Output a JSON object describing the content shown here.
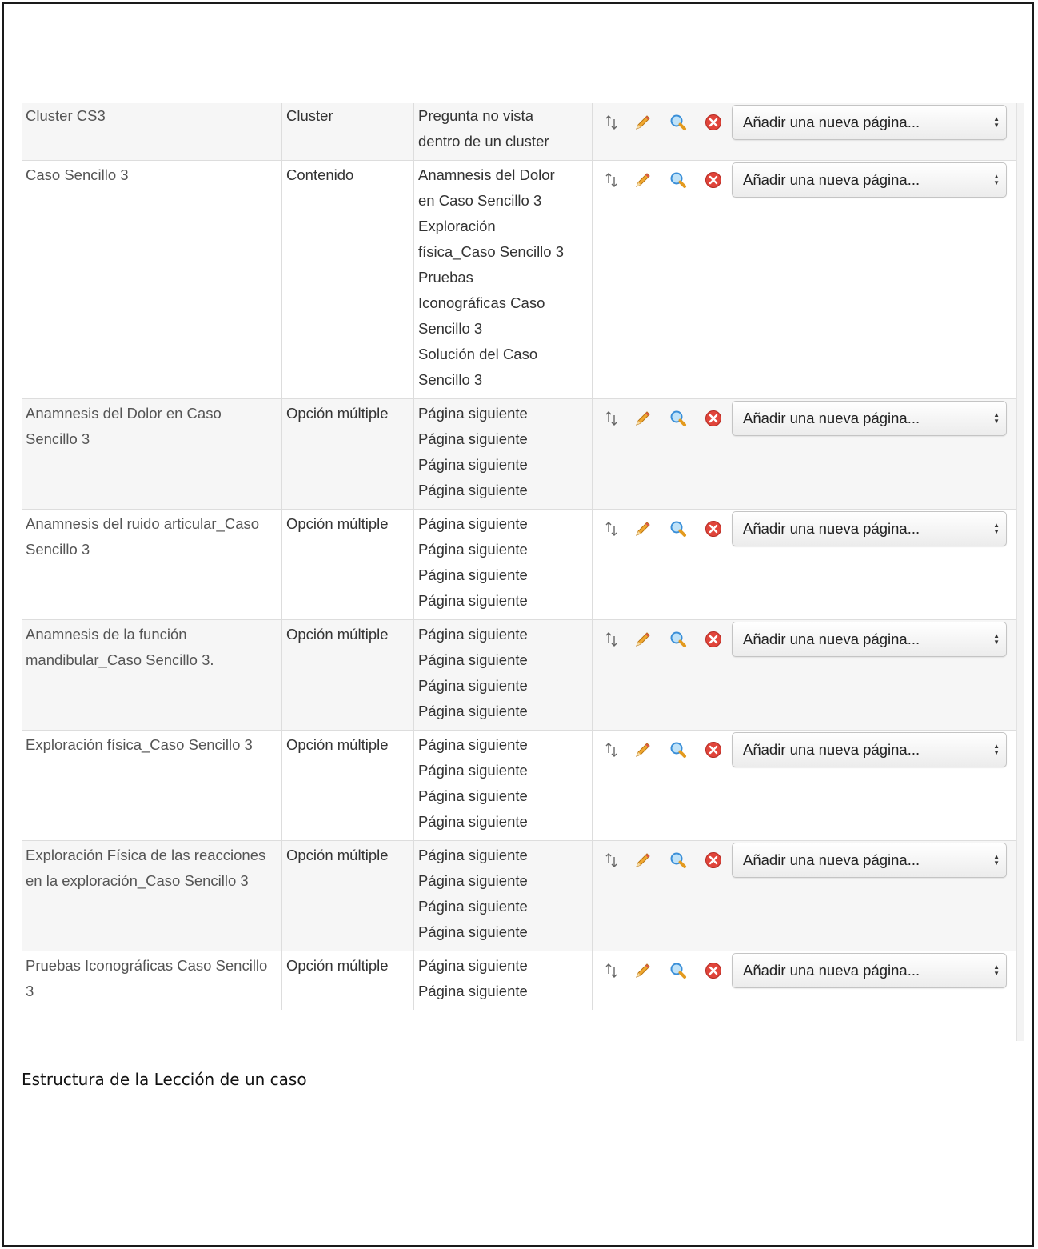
{
  "colors": {
    "row_alt": "#f6f6f6",
    "border": "#dddddd",
    "pencil": "#f0a830",
    "search": "#3a8fd8",
    "delete": "#e0453b"
  },
  "icons": {
    "move": "move-arrows-icon",
    "edit": "pencil-icon",
    "preview": "magnifier-icon",
    "delete": "delete-icon"
  },
  "rows": [
    {
      "title": "Cluster CS3",
      "type": "Cluster",
      "jumps": [
        "Pregunta no vista",
        "dentro de un cluster"
      ],
      "select": "Añadir una nueva página..."
    },
    {
      "title": "Caso Sencillo 3",
      "type": "Contenido",
      "jumps": [
        "Anamnesis del Dolor",
        "en Caso Sencillo 3",
        "Exploración",
        "física_Caso Sencillo 3",
        "Pruebas",
        "Iconográficas Caso",
        "Sencillo 3",
        "Solución del Caso",
        "Sencillo 3"
      ],
      "select": "Añadir una nueva página..."
    },
    {
      "title": "Anamnesis del Dolor en Caso Sencillo 3",
      "type": "Opción múltiple",
      "jumps": [
        "Página siguiente",
        "Página siguiente",
        "Página siguiente",
        "Página siguiente"
      ],
      "select": "Añadir una nueva página..."
    },
    {
      "title": "Anamnesis del ruido articular_Caso Sencillo 3",
      "type": "Opción múltiple",
      "jumps": [
        "Página siguiente",
        "Página siguiente",
        "Página siguiente",
        "Página siguiente"
      ],
      "select": "Añadir una nueva página..."
    },
    {
      "title": "Anamnesis de la función mandibular_Caso Sencillo 3.",
      "type": "Opción múltiple",
      "jumps": [
        "Página siguiente",
        "Página siguiente",
        "Página siguiente",
        "Página siguiente"
      ],
      "select": "Añadir una nueva página..."
    },
    {
      "title": "Exploración física_Caso Sencillo 3",
      "type": "Opción múltiple",
      "jumps": [
        "Página siguiente",
        "Página siguiente",
        "Página siguiente",
        "Página siguiente"
      ],
      "select": "Añadir una nueva página..."
    },
    {
      "title": "Exploración Física de las reacciones en la exploración_Caso Sencillo 3",
      "type": "Opción múltiple",
      "jumps": [
        "Página siguiente",
        "Página siguiente",
        "Página siguiente",
        "Página siguiente"
      ],
      "select": "Añadir una nueva página..."
    },
    {
      "title": "Pruebas Iconográficas Caso Sencillo 3",
      "type": "Opción múltiple",
      "jumps": [
        "Página siguiente",
        "Página siguiente"
      ],
      "select": "Añadir una nueva página..."
    }
  ],
  "caption": "Estructura de la Lección de un caso"
}
